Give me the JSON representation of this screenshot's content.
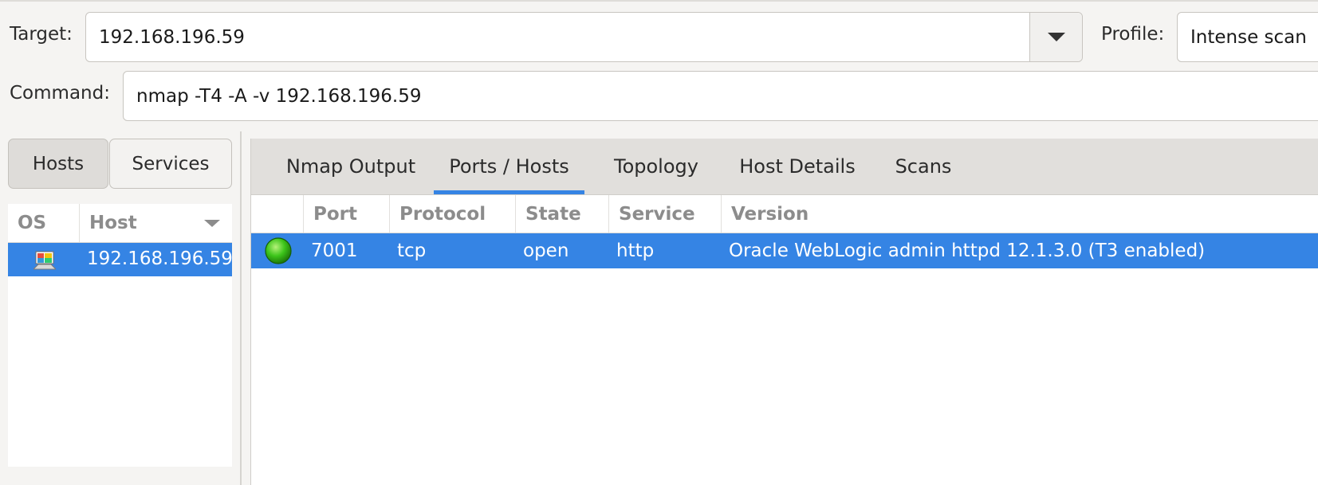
{
  "toolbar": {
    "target_label": "Target:",
    "target_value": "192.168.196.59",
    "profile_label": "Profile:",
    "profile_value": "Intense scan",
    "command_label": "Command:",
    "command_value": "nmap -T4 -A -v 192.168.196.59",
    "dropdown_icon": "chevron-down-icon"
  },
  "left_panel": {
    "toggle_hosts": "Hosts",
    "toggle_services": "Services",
    "columns": [
      "OS",
      "Host"
    ],
    "hosts": [
      {
        "os_icon": "os-unknown-icon",
        "address": "192.168.196.59"
      }
    ]
  },
  "tabs": [
    "Nmap Output",
    "Ports / Hosts",
    "Topology",
    "Host Details",
    "Scans"
  ],
  "active_tab": "Ports / Hosts",
  "ports_table": {
    "columns": [
      "",
      "Port",
      "Protocol",
      "State",
      "Service",
      "Version"
    ],
    "rows": [
      {
        "status_icon": "green-status-icon",
        "port": "7001",
        "protocol": "tcp",
        "state": "open",
        "service": "http",
        "version": "Oracle WebLogic admin httpd 12.1.3.0 (T3 enabled)"
      }
    ]
  },
  "colors": {
    "selection": "#3584e4",
    "status_open": "#3cc41a",
    "window_bg": "#f5f4f2"
  }
}
